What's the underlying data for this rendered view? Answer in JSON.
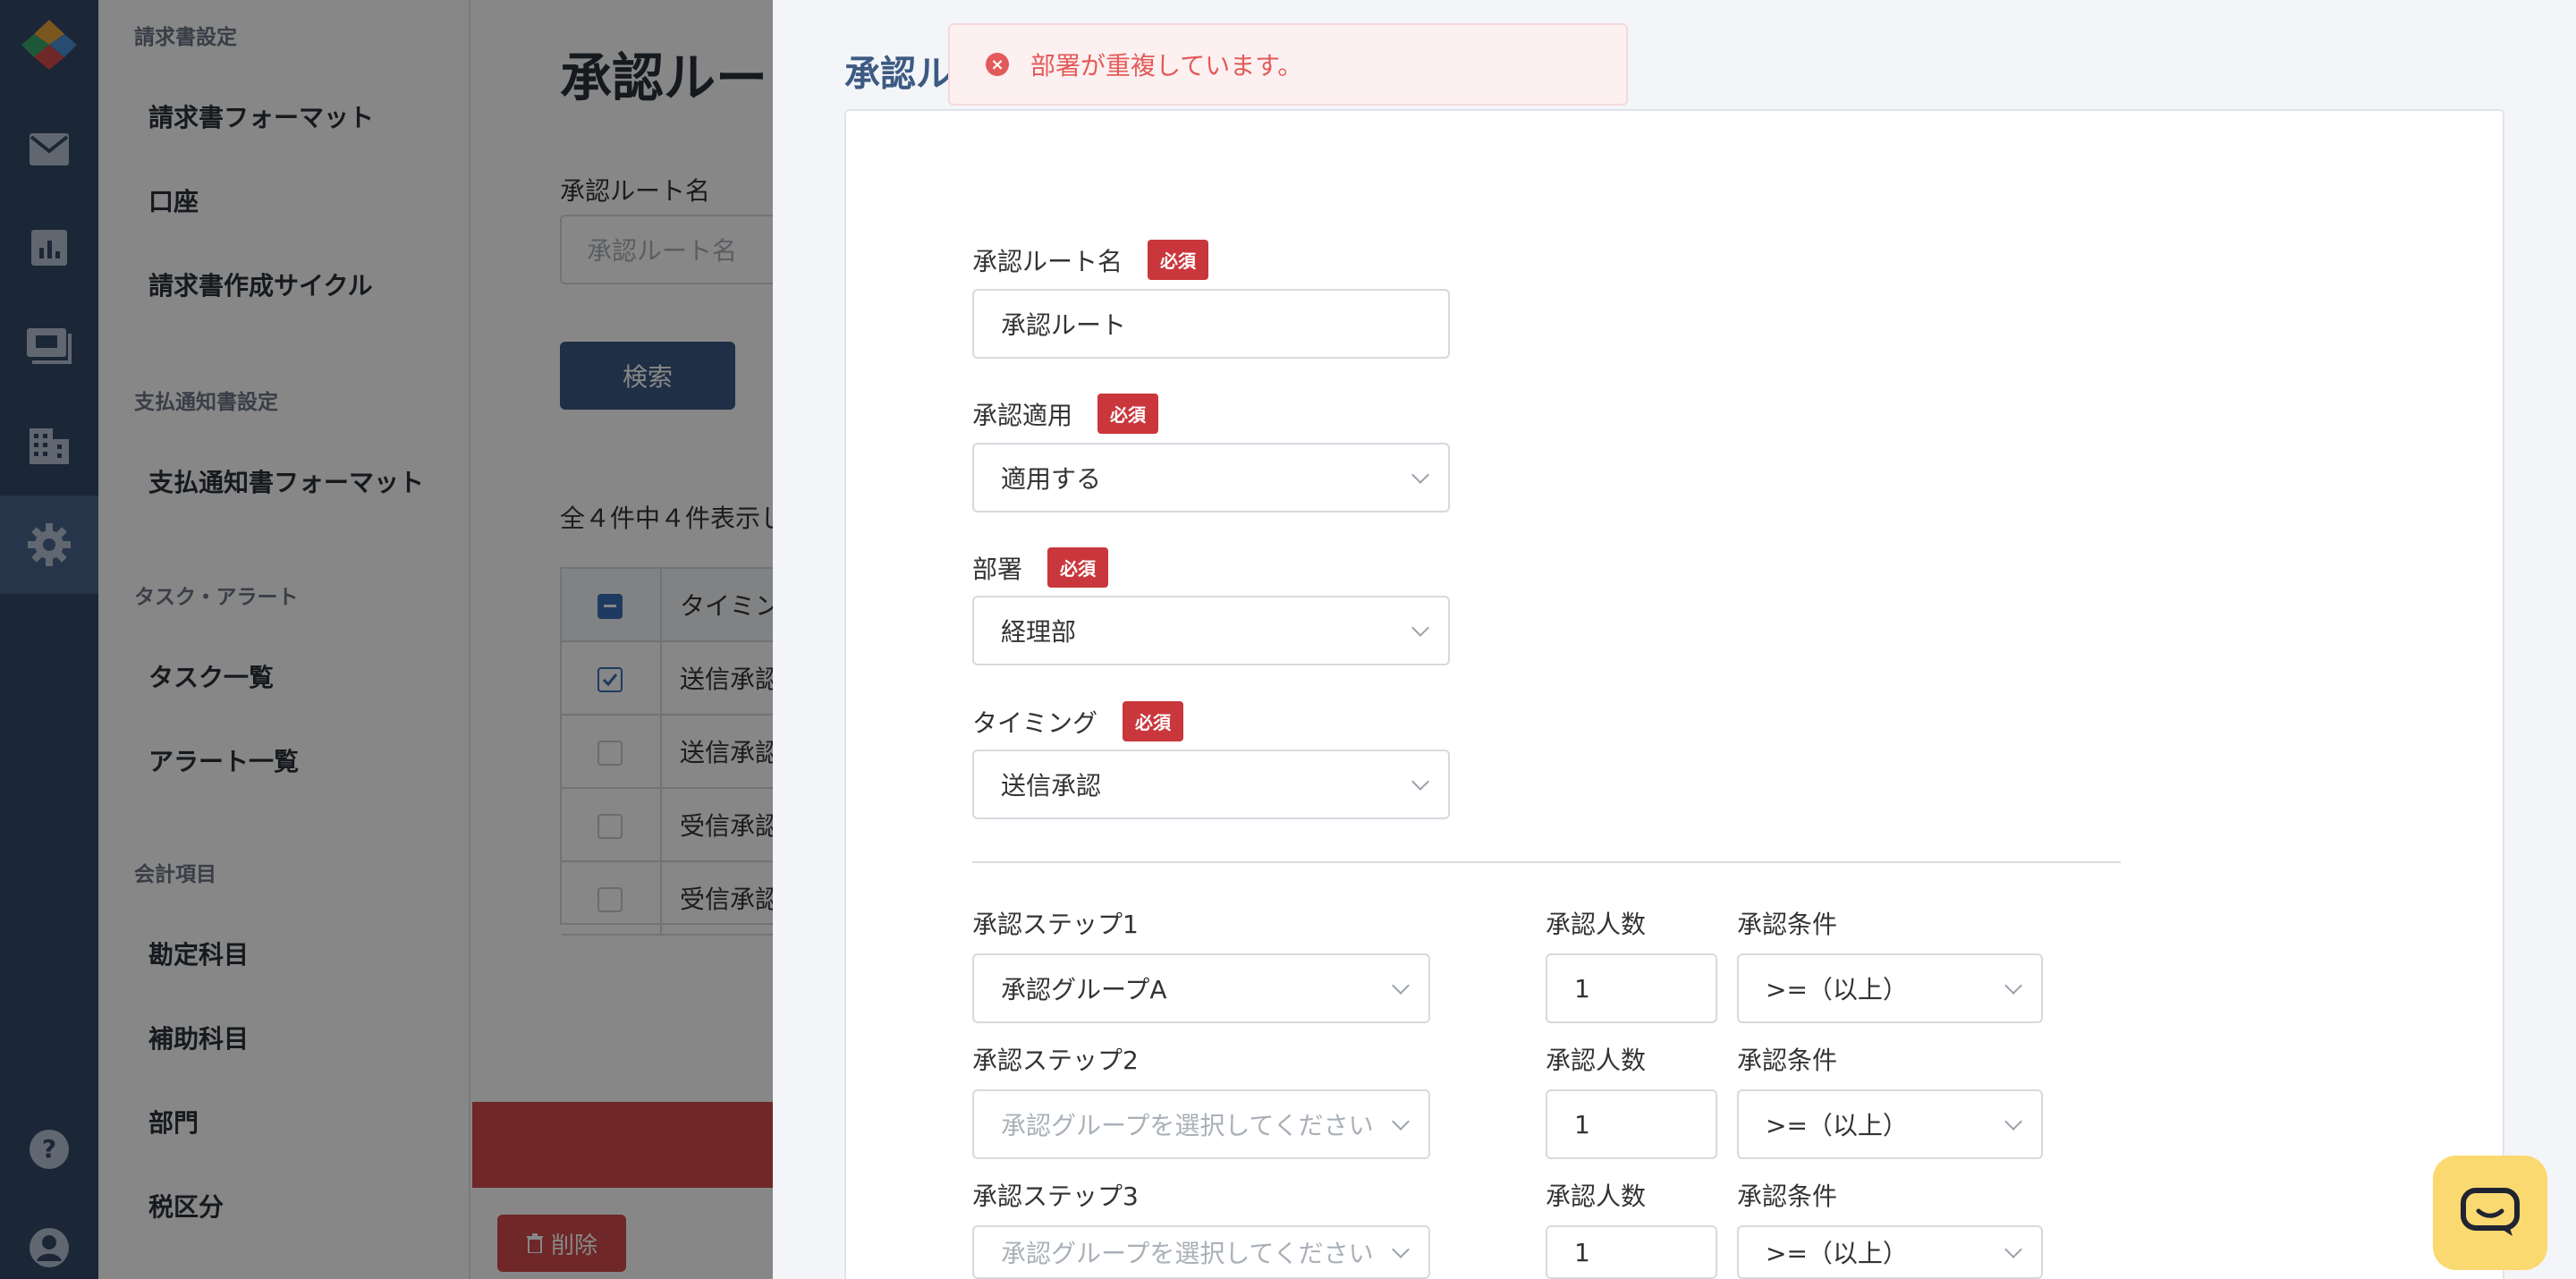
{
  "colors": {
    "rail_bg": "#334866",
    "accent": "#3c5a82",
    "required_badge": "#c9373c",
    "error_text": "#e35a5a",
    "chat_widget": "#fbd971"
  },
  "rail": {
    "icons": [
      "logo-icon",
      "mail-icon",
      "chart-icon",
      "payment-icon",
      "building-icon",
      "gear-icon",
      "help-icon",
      "user-icon"
    ],
    "active": "gear-icon"
  },
  "sidebar": {
    "sections": [
      {
        "title": "請求書設定",
        "items": [
          "請求書フォーマット",
          "口座",
          "請求書作成サイクル"
        ]
      },
      {
        "title": "支払通知書設定",
        "items": [
          "支払通知書フォーマット"
        ]
      },
      {
        "title": "タスク・アラート",
        "items": [
          "タスク一覧",
          "アラート一覧"
        ]
      },
      {
        "title": "会計項目",
        "items": [
          "勘定科目",
          "補助科目",
          "部門",
          "税区分"
        ]
      }
    ]
  },
  "main": {
    "title": "承認ルー",
    "search_label": "承認ルート名",
    "search_placeholder": "承認ルート名",
    "search_button": "検索",
    "count_text": "全４件中４件表示し",
    "table": {
      "header": "タイミン",
      "rows": [
        "送信承認",
        "送信承認",
        "受信承認",
        "受信承認"
      ]
    },
    "delete_button": "削除"
  },
  "drawer": {
    "title": "承認ル",
    "required_label": "必須",
    "fields": {
      "route_name": {
        "label": "承認ルート名",
        "value": "承認ルート"
      },
      "apply": {
        "label": "承認適用",
        "value": "適用する"
      },
      "department": {
        "label": "部署",
        "value": "経理部"
      },
      "timing": {
        "label": "タイミング",
        "value": "送信承認"
      }
    },
    "steps": [
      {
        "label": "承認ステップ1",
        "group_value": "承認グループA",
        "group_placeholder": "",
        "count_label": "承認人数",
        "count_value": "1",
        "condition_label": "承認条件",
        "condition_value": ">=（以上）"
      },
      {
        "label": "承認ステップ2",
        "group_value": "",
        "group_placeholder": "承認グループを選択してください",
        "count_label": "承認人数",
        "count_value": "1",
        "condition_label": "承認条件",
        "condition_value": ">=（以上）"
      },
      {
        "label": "承認ステップ3",
        "group_value": "",
        "group_placeholder": "承認グループを選択してください",
        "count_label": "承認人数",
        "count_value": "1",
        "condition_label": "承認条件",
        "condition_value": ">=（以上）"
      }
    ]
  },
  "toast": {
    "message": "部署が重複しています。"
  }
}
